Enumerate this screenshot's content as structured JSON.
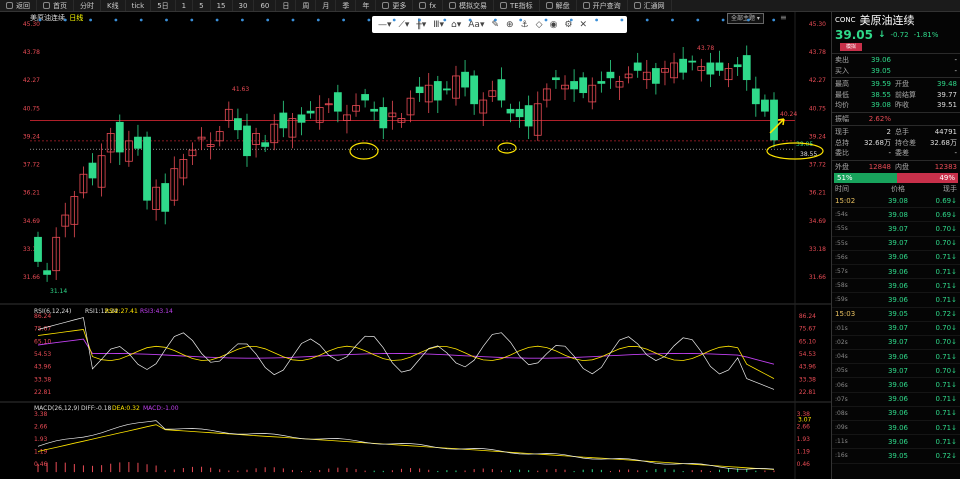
{
  "toolbar": {
    "items": [
      "返回",
      "首页",
      "分时",
      "K线",
      "tick",
      "5日",
      "1",
      "5",
      "15",
      "30",
      "60",
      "日",
      "周",
      "月",
      "季",
      "年",
      "更多",
      "fx",
      "模拟交易",
      "TE指标",
      "解盘",
      "开户查询",
      "汇通网"
    ]
  },
  "chart": {
    "symbol": "美原油连续",
    "period_tag": "日线",
    "period_select": "全部主题",
    "rsi_legend": "RSI(6,12,24)",
    "rsi1": "RSI1:12.24",
    "rsi2": "RSI2:27.41",
    "rsi3": "RSI3:43.14",
    "macd_legend": "MACD(26,12,9)",
    "diff": "DIFF:-0.18",
    "dea": "DEA:0.32",
    "macd": "MACD:-1.00",
    "price_ticks": [
      "45.30",
      "43.78",
      "42.27",
      "40.75",
      "39.24",
      "37.72",
      "36.21",
      "34.69",
      "33.18",
      "31.66"
    ],
    "rsi_ticks": [
      "86.24",
      "75.67",
      "65.10",
      "54.53",
      "43.96",
      "33.38",
      "22.81"
    ],
    "macd_ticks": [
      "3.38",
      "2.66",
      "1.93",
      "1.19",
      "0.46"
    ],
    "label_high": "43.78",
    "label_mid": "41.63",
    "label_low": "31.14",
    "label_last": "40.24",
    "label_cur": "39.05",
    "label_hl": "38.55",
    "label_macd": "3.07",
    "colors": {
      "up": "#e84b55",
      "down": "#2fd98a",
      "yellow": "#ffe500",
      "purple": "#c040f0"
    }
  },
  "quote": {
    "code": "CONC",
    "name": "美原油连续",
    "price": "39.05",
    "arrow": "↓",
    "change": "-0.72",
    "pct": "-1.81%",
    "flag": "模拟",
    "rows": [
      {
        "l": "卖出",
        "v": "39.06",
        "l2": "",
        "v2": "-"
      },
      {
        "l": "买入",
        "v": "39.05",
        "l2": "",
        "v2": "-"
      },
      {
        "l": "最高",
        "v": "39.59",
        "l2": "开盘",
        "v2": "39.48"
      },
      {
        "l": "最低",
        "v": "38.55",
        "l2": "前结算",
        "v2": "39.77"
      },
      {
        "l": "均价",
        "v": "39.08",
        "l2": "昨收",
        "v2": "39.51"
      },
      {
        "l": "振幅",
        "v": "2.62%",
        "l2": "",
        "v2": ""
      },
      {
        "l": "现手",
        "v": "2",
        "l2": "总手",
        "v2": "44791"
      },
      {
        "l": "总持",
        "v": "32.68万",
        "l2": "持仓差",
        "v2": "32.68万"
      },
      {
        "l": "委比",
        "v": "-",
        "l2": "委差",
        "v2": "-"
      },
      {
        "l": "外盘",
        "v": "12848",
        "l2": "内盘",
        "v2": "12383"
      }
    ],
    "buy_pct": "51%",
    "sell_pct": "49%",
    "buy_ratio": 0.51,
    "th_time": "时间",
    "th_price": "价格",
    "th_vol": "现手",
    "ticks": [
      {
        "t": "15:02",
        "p": "39.08",
        "v": "0.69"
      },
      {
        "t": ":54s",
        "p": "39.08",
        "v": "0.69"
      },
      {
        "t": ":55s",
        "p": "39.07",
        "v": "0.70"
      },
      {
        "t": ":55s",
        "p": "39.07",
        "v": "0.70"
      },
      {
        "t": ":56s",
        "p": "39.06",
        "v": "0.71"
      },
      {
        "t": ":57s",
        "p": "39.06",
        "v": "0.71"
      },
      {
        "t": ":58s",
        "p": "39.06",
        "v": "0.71"
      },
      {
        "t": ":59s",
        "p": "39.06",
        "v": "0.71"
      },
      {
        "t": "15:03",
        "p": "39.05",
        "v": "0.72"
      },
      {
        "t": ":01s",
        "p": "39.07",
        "v": "0.70"
      },
      {
        "t": ":02s",
        "p": "39.07",
        "v": "0.70"
      },
      {
        "t": ":04s",
        "p": "39.06",
        "v": "0.71"
      },
      {
        "t": ":05s",
        "p": "39.07",
        "v": "0.70"
      },
      {
        "t": ":06s",
        "p": "39.06",
        "v": "0.71"
      },
      {
        "t": ":07s",
        "p": "39.06",
        "v": "0.71"
      },
      {
        "t": ":08s",
        "p": "39.06",
        "v": "0.71"
      },
      {
        "t": ":09s",
        "p": "39.06",
        "v": "0.71"
      },
      {
        "t": ":11s",
        "p": "39.06",
        "v": "0.71"
      },
      {
        "t": ":16s",
        "p": "39.05",
        "v": "0.72"
      }
    ]
  }
}
